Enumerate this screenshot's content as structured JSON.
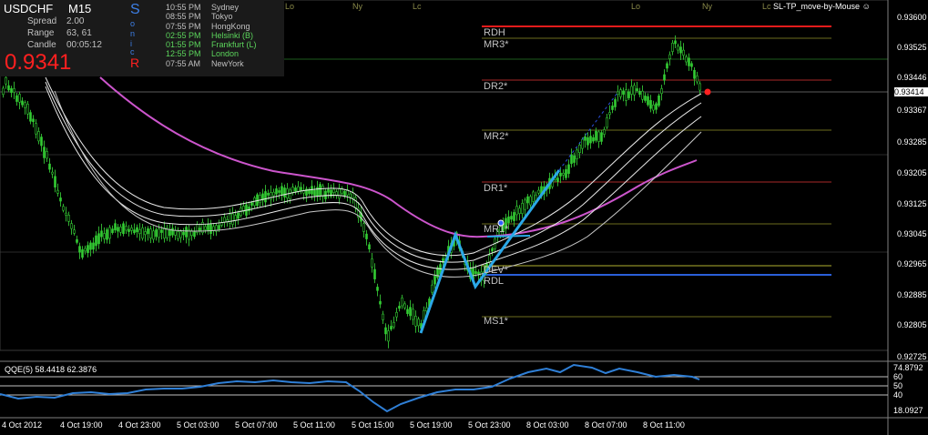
{
  "colors": {
    "background": "#000000",
    "candle": "#33cc33",
    "ma_magenta": "#cc55cc",
    "bands": "#e8e8e8",
    "trend": "#2ba8e8",
    "rdh": "#e41b1b",
    "resistance": "#d33a3a",
    "mid": "#8a8a2a",
    "support_blue": "#2a5fd8",
    "qqe_line": "#2f7fd6",
    "price_tag": "#ffffff"
  },
  "symbol_panel": {
    "symbol": "USDCHF",
    "timeframe": "M15",
    "spread_label": "Spread",
    "spread_value": "2.00",
    "range_label": "Range",
    "range_value": "63, 61",
    "candle_label": "Candle",
    "candle_value": "00:05:12",
    "bid": "0.9341"
  },
  "sonic_letters": [
    "S",
    "o",
    "n",
    "i",
    "c",
    "R"
  ],
  "sessions": [
    {
      "time": "10:55 PM",
      "city": "Sydney",
      "color": "#c0c0c0"
    },
    {
      "time": "08:55 PM",
      "city": "Tokyo",
      "color": "#c0c0c0"
    },
    {
      "time": "07:55 PM",
      "city": "HongKong",
      "color": "#c0c0c0"
    },
    {
      "time": "02:55 PM",
      "city": "Helsinki  (B)",
      "color": "#5cd65c"
    },
    {
      "time": "01:55 PM",
      "city": "Frankfurt  (L)",
      "color": "#5cd65c"
    },
    {
      "time": "12:55 PM",
      "city": "London",
      "color": "#5cd65c"
    },
    {
      "time": "07:55 AM",
      "city": "NewYork",
      "color": "#c0c0c0"
    }
  ],
  "top_session_labels": [
    "Lo",
    "Ny",
    "Lc",
    "Lo",
    "Ny",
    "Lc"
  ],
  "tool_label": "SL-TP_move-by-Mouse",
  "level_labels": [
    "RDH",
    "MR3*",
    "DR2*",
    "MR2*",
    "DR1*",
    "MR1*",
    "DEV*",
    "RDL",
    "MS1*"
  ],
  "price_axis": [
    "0.93600",
    "0.93525",
    "0.93446",
    "0.93414",
    "0.93367",
    "0.93285",
    "0.93205",
    "0.93125",
    "0.93045",
    "0.92965",
    "0.92885",
    "0.92805",
    "0.92725"
  ],
  "current_price": "0.93414",
  "indicator": {
    "title": "QQE(5) 58.4418 62.3876",
    "axis": [
      "74.8792",
      "60",
      "50",
      "40",
      "18.0927"
    ]
  },
  "time_axis": [
    "4 Oct 2012",
    "4 Oct 19:00",
    "4 Oct 23:00",
    "5 Oct 03:00",
    "5 Oct 07:00",
    "5 Oct 11:00",
    "5 Oct 15:00",
    "5 Oct 19:00",
    "5 Oct 23:00",
    "8 Oct 03:00",
    "8 Oct 07:00",
    "8 Oct 11:00"
  ]
}
